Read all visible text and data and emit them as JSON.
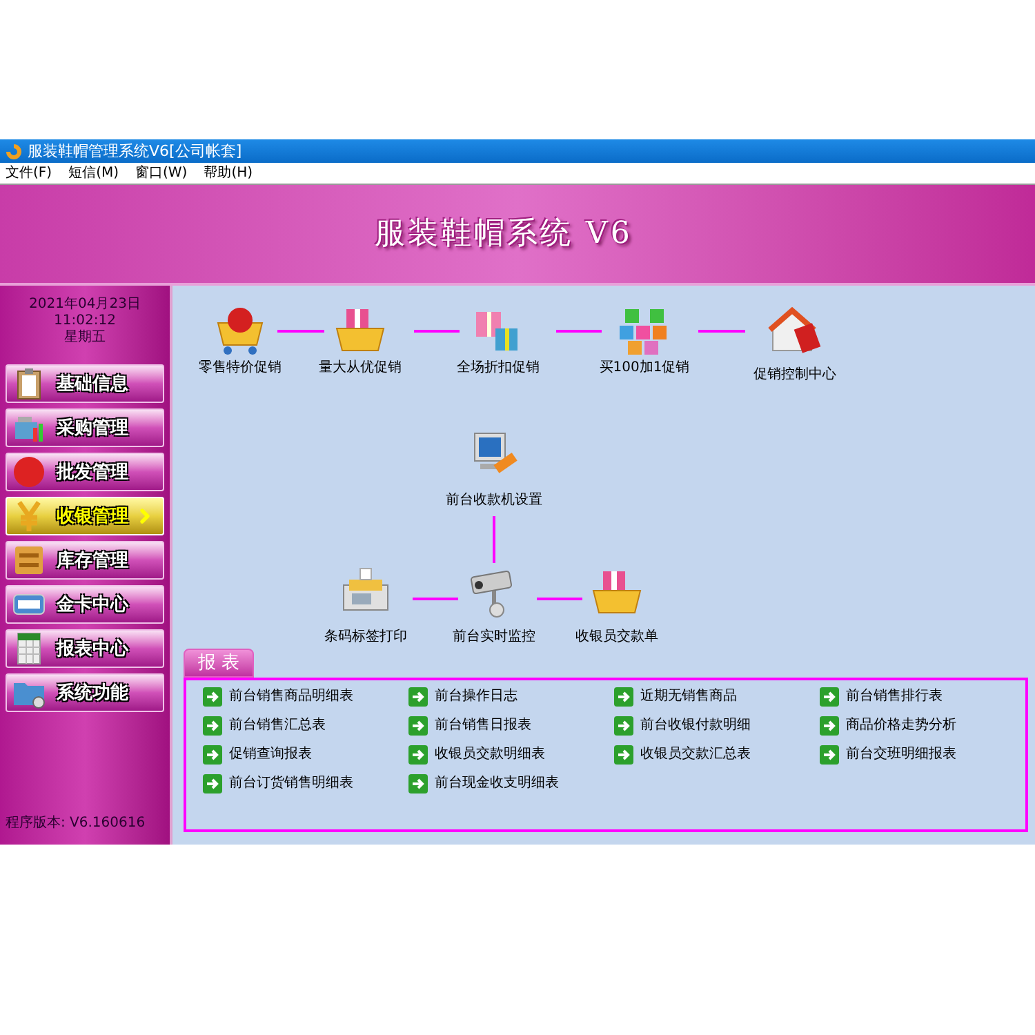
{
  "window": {
    "title": "服装鞋帽管理系统V6[公司帐套]"
  },
  "menu": [
    "文件(F)",
    "短信(M)",
    "窗口(W)",
    "帮助(H)"
  ],
  "banner": {
    "title": "服装鞋帽系统 V6"
  },
  "clock": {
    "date": "2021年04月23日",
    "time": "11:02:12",
    "weekday": "星期五"
  },
  "sidebar": {
    "items": [
      {
        "label": "基础信息",
        "selected": false
      },
      {
        "label": "采购管理",
        "selected": false
      },
      {
        "label": "批发管理",
        "selected": false
      },
      {
        "label": "收银管理",
        "selected": true
      },
      {
        "label": "库存管理",
        "selected": false
      },
      {
        "label": "金卡中心",
        "selected": false
      },
      {
        "label": "报表中心",
        "selected": false
      },
      {
        "label": "系统功能",
        "selected": false
      }
    ],
    "version": "程序版本: V6.160616"
  },
  "flow": {
    "nodes": [
      {
        "label": "零售特价促销"
      },
      {
        "label": "量大从优促销"
      },
      {
        "label": "全场折扣促销"
      },
      {
        "label": "买100加1促销"
      },
      {
        "label": "促销控制中心"
      },
      {
        "label": "前台收款机设置"
      },
      {
        "label": "条码标签打印"
      },
      {
        "label": "前台实时监控"
      },
      {
        "label": "收银员交款单"
      }
    ]
  },
  "reports": {
    "tab": "报 表",
    "items": [
      "前台销售商品明细表",
      "前台操作日志",
      "近期无销售商品",
      "前台销售排行表",
      "前台销售汇总表",
      "前台销售日报表",
      "前台收银付款明细",
      "商品价格走势分析",
      "促销查询报表",
      "收银员交款明细表",
      "收银员交款汇总表",
      "前台交班明细报表",
      "前台订货销售明细表",
      "前台现金收支明细表"
    ]
  }
}
